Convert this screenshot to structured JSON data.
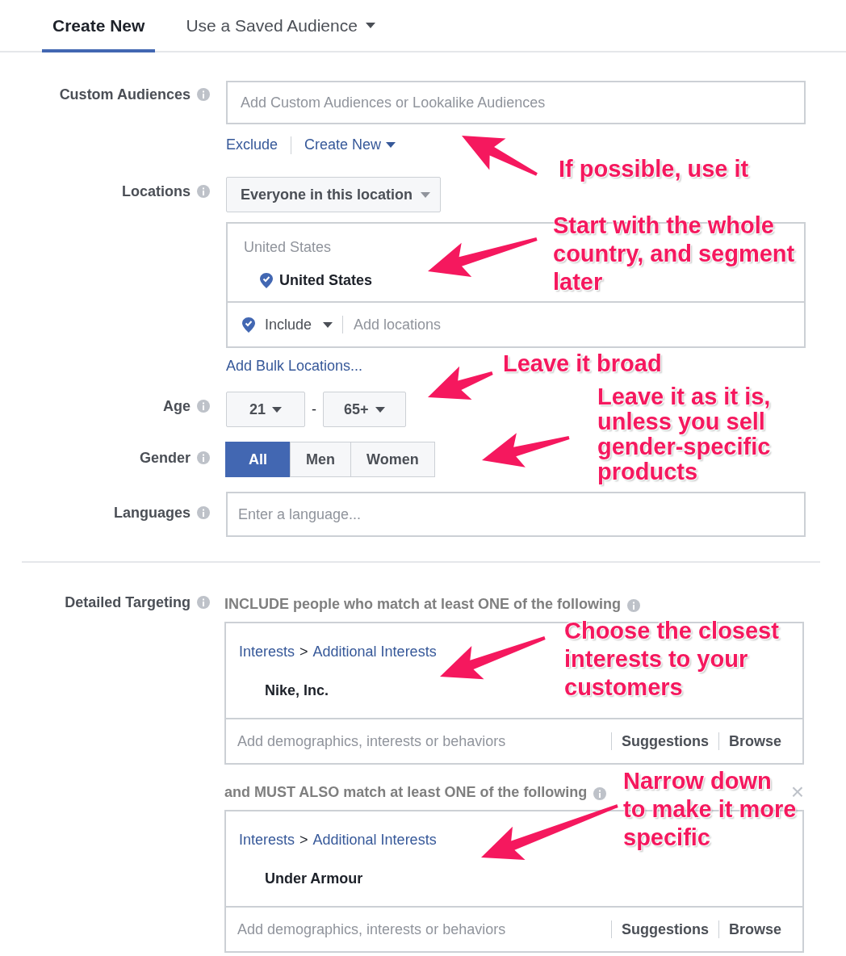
{
  "tabs": [
    {
      "label": "Create New",
      "selected": true,
      "kind": "tab"
    },
    {
      "label": "Use a Saved Audience",
      "selected": false,
      "kind": "dropdown"
    }
  ],
  "custom_audiences": {
    "label": "Custom Audiences",
    "placeholder": "Add Custom Audiences or Lookalike Audiences",
    "links": [
      {
        "label": "Exclude",
        "kind": "link"
      },
      {
        "label": "Create New",
        "kind": "dropdown"
      }
    ]
  },
  "locations": {
    "label": "Locations",
    "selector": "Everyone in this location",
    "group_title": "United States",
    "items": [
      "United States"
    ],
    "mode": "Include",
    "placeholder": "Add locations",
    "bulk_link": "Add Bulk Locations..."
  },
  "age": {
    "label": "Age",
    "min": "21",
    "separator": "-",
    "max": "65+"
  },
  "gender": {
    "label": "Gender",
    "options": [
      {
        "label": "All",
        "selected": true
      },
      {
        "label": "Men",
        "selected": false
      },
      {
        "label": "Women",
        "selected": false
      }
    ]
  },
  "languages": {
    "label": "Languages",
    "placeholder": "Enter a language..."
  },
  "detailed_targeting": {
    "label": "Detailed Targeting",
    "groups": [
      {
        "heading": "INCLUDE people who match at least ONE of the following",
        "closable": false,
        "category": "Interests",
        "separator": ">",
        "subcategory": "Additional Interests",
        "item": "Nike, Inc.",
        "placeholder": "Add demographics, interests or behaviors",
        "actions": [
          "Suggestions",
          "Browse"
        ]
      },
      {
        "heading": "and MUST ALSO match at least ONE of the following",
        "closable": true,
        "close": "×",
        "category": "Interests",
        "separator": ">",
        "subcategory": "Additional Interests",
        "item": "Under Armour",
        "placeholder": "Add demographics, interests or behaviors",
        "actions": [
          "Suggestions",
          "Browse"
        ]
      }
    ]
  },
  "annotations": [
    {
      "lines": [
        "If possible, use it"
      ]
    },
    {
      "lines": [
        "Start with the whole",
        "country, and segment",
        "later"
      ]
    },
    {
      "lines": [
        "Leave it broad"
      ]
    },
    {
      "lines": [
        "Leave it as it is,",
        "unless you sell",
        "gender-specific",
        "products"
      ]
    },
    {
      "lines": [
        "Choose the closest",
        "interests to your",
        "customers"
      ]
    },
    {
      "lines": [
        "Narrow down",
        "to make it more",
        "specific"
      ]
    }
  ]
}
